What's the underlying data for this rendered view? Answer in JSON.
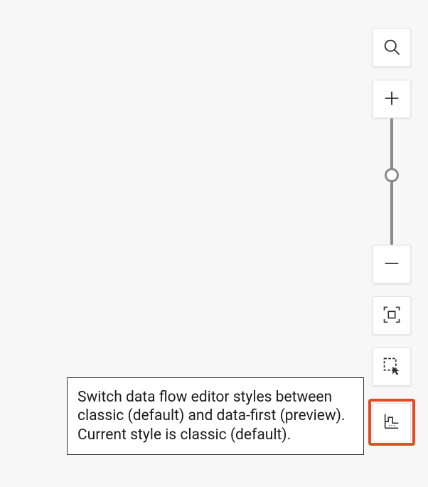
{
  "tooltip": {
    "text": "Switch data flow editor styles between classic (default) and data-first (preview). Current style is classic (default)."
  },
  "toolbar": {
    "search_label": "Search",
    "zoom_in_label": "Zoom in",
    "zoom_out_label": "Zoom out",
    "fit_to_screen_label": "Fit to screen",
    "selection_mode_label": "Selection mode",
    "switch_style_label": "Switch editor style"
  }
}
